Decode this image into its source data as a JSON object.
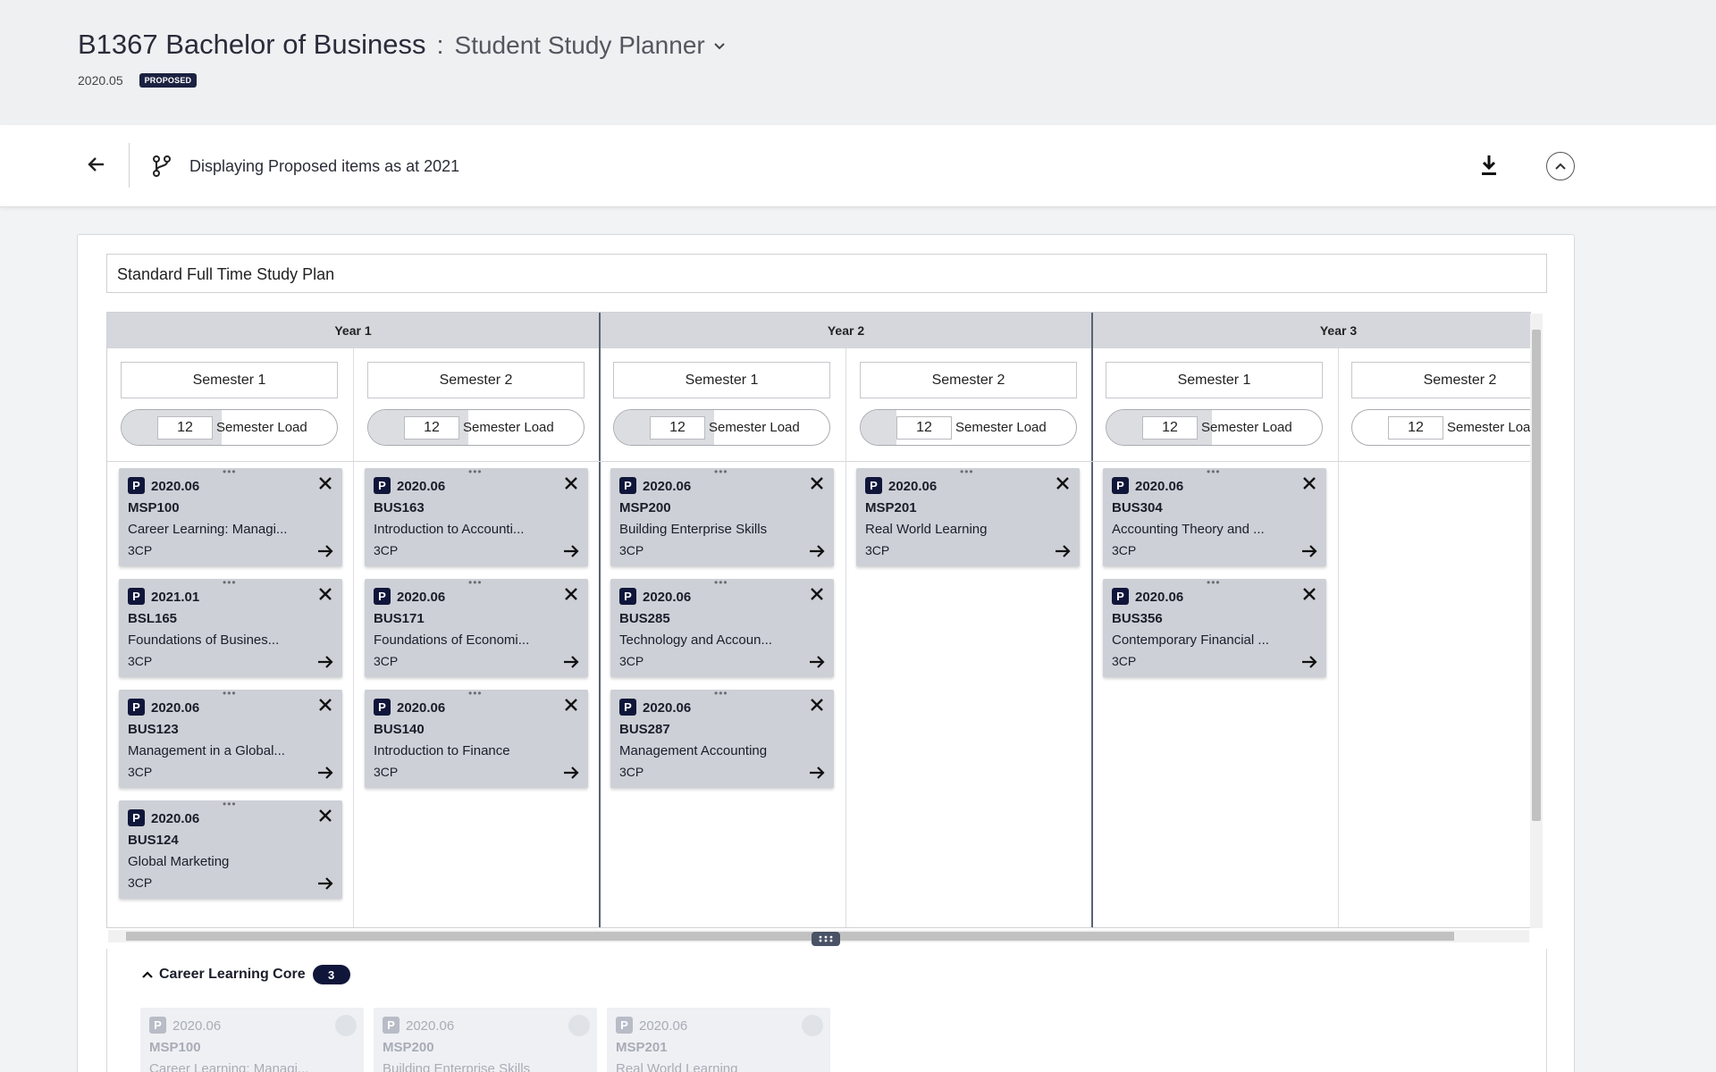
{
  "header": {
    "course_code": "B1367 Bachelor of Business",
    "separator": ":",
    "view_name": "Student Study Planner",
    "version": "2020.05",
    "status_badge": "PROPOSED"
  },
  "toolbar": {
    "back_icon": "arrow-left-icon",
    "branch_icon": "branch-icon",
    "message": "Displaying Proposed items as at 2021",
    "download_icon": "download-icon",
    "collapse_icon": "chevron-up-icon"
  },
  "plan": {
    "name": "Standard Full Time Study Plan",
    "years": [
      "Year 1",
      "Year 2",
      "Year 3"
    ],
    "semesters": [
      {
        "label": "Semester 1",
        "load": "12",
        "load_label": "Semester Load"
      },
      {
        "label": "Semester 2",
        "load": "12",
        "load_label": "Semester Load"
      },
      {
        "label": "Semester 1",
        "load": "12",
        "load_label": "Semester Load"
      },
      {
        "label": "Semester 2",
        "load": "12",
        "load_label": "Semester Load"
      },
      {
        "label": "Semester 1",
        "load": "12",
        "load_label": "Semester Load"
      },
      {
        "label": "Semester 2",
        "load": "12",
        "load_label": "Semester Load"
      }
    ],
    "columns": [
      [
        {
          "badge": "P",
          "version": "2020.06",
          "code": "MSP100",
          "title": "Career Learning: Managi...",
          "cp": "3CP"
        },
        {
          "badge": "P",
          "version": "2021.01",
          "code": "BSL165",
          "title": "Foundations of Busines...",
          "cp": "3CP"
        },
        {
          "badge": "P",
          "version": "2020.06",
          "code": "BUS123",
          "title": "Management in a Global...",
          "cp": "3CP"
        },
        {
          "badge": "P",
          "version": "2020.06",
          "code": "BUS124",
          "title": "Global Marketing",
          "cp": "3CP"
        }
      ],
      [
        {
          "badge": "P",
          "version": "2020.06",
          "code": "BUS163",
          "title": "Introduction to Accounti...",
          "cp": "3CP"
        },
        {
          "badge": "P",
          "version": "2020.06",
          "code": "BUS171",
          "title": "Foundations of Economi...",
          "cp": "3CP"
        },
        {
          "badge": "P",
          "version": "2020.06",
          "code": "BUS140",
          "title": "Introduction to Finance",
          "cp": "3CP"
        }
      ],
      [
        {
          "badge": "P",
          "version": "2020.06",
          "code": "MSP200",
          "title": "Building Enterprise Skills",
          "cp": "3CP"
        },
        {
          "badge": "P",
          "version": "2020.06",
          "code": "BUS285",
          "title": "Technology and Accoun...",
          "cp": "3CP"
        },
        {
          "badge": "P",
          "version": "2020.06",
          "code": "BUS287",
          "title": "Management Accounting",
          "cp": "3CP"
        }
      ],
      [
        {
          "badge": "P",
          "version": "2020.06",
          "code": "MSP201",
          "title": "Real World Learning",
          "cp": "3CP"
        }
      ],
      [
        {
          "badge": "P",
          "version": "2020.06",
          "code": "BUS304",
          "title": "Accounting Theory and ...",
          "cp": "3CP"
        },
        {
          "badge": "P",
          "version": "2020.06",
          "code": "BUS356",
          "title": "Contemporary Financial ...",
          "cp": "3CP"
        }
      ],
      []
    ]
  },
  "core": {
    "title": "Career Learning Core",
    "count": "3",
    "items": [
      {
        "badge": "P",
        "version": "2020.06",
        "code": "MSP100",
        "title": "Career Learning: Managi..."
      },
      {
        "badge": "P",
        "version": "2020.06",
        "code": "MSP200",
        "title": "Building Enterprise Skills"
      },
      {
        "badge": "P",
        "version": "2020.06",
        "code": "MSP201",
        "title": "Real World Learning"
      }
    ]
  },
  "colors": {
    "accent": "#10163a",
    "card_bg": "#cdd0d6",
    "header_bg": "#eff0f2"
  }
}
